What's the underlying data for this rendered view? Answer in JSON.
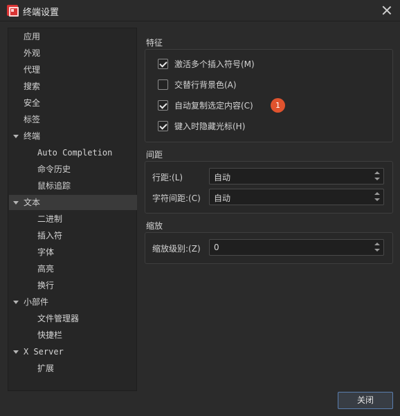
{
  "window": {
    "title": "终端设置"
  },
  "sidebar": {
    "items": [
      {
        "label": "应用",
        "level": 0,
        "expandable": false,
        "selected": false,
        "mono": false
      },
      {
        "label": "外观",
        "level": 0,
        "expandable": false,
        "selected": false,
        "mono": false
      },
      {
        "label": "代理",
        "level": 0,
        "expandable": false,
        "selected": false,
        "mono": false
      },
      {
        "label": "搜索",
        "level": 0,
        "expandable": false,
        "selected": false,
        "mono": false
      },
      {
        "label": "安全",
        "level": 0,
        "expandable": false,
        "selected": false,
        "mono": false
      },
      {
        "label": "标签",
        "level": 0,
        "expandable": false,
        "selected": false,
        "mono": false
      },
      {
        "label": "终端",
        "level": 0,
        "expandable": true,
        "selected": false,
        "mono": false
      },
      {
        "label": "Auto Completion",
        "level": 1,
        "expandable": false,
        "selected": false,
        "mono": true
      },
      {
        "label": "命令历史",
        "level": 1,
        "expandable": false,
        "selected": false,
        "mono": false
      },
      {
        "label": "鼠标追踪",
        "level": 1,
        "expandable": false,
        "selected": false,
        "mono": false
      },
      {
        "label": "文本",
        "level": 0,
        "expandable": true,
        "selected": true,
        "mono": false
      },
      {
        "label": "二进制",
        "level": 1,
        "expandable": false,
        "selected": false,
        "mono": false
      },
      {
        "label": "插入符",
        "level": 1,
        "expandable": false,
        "selected": false,
        "mono": false
      },
      {
        "label": "字体",
        "level": 1,
        "expandable": false,
        "selected": false,
        "mono": false
      },
      {
        "label": "高亮",
        "level": 1,
        "expandable": false,
        "selected": false,
        "mono": false
      },
      {
        "label": "换行",
        "level": 1,
        "expandable": false,
        "selected": false,
        "mono": false
      },
      {
        "label": "小部件",
        "level": 0,
        "expandable": true,
        "selected": false,
        "mono": false
      },
      {
        "label": "文件管理器",
        "level": 1,
        "expandable": false,
        "selected": false,
        "mono": false
      },
      {
        "label": "快捷栏",
        "level": 1,
        "expandable": false,
        "selected": false,
        "mono": false
      },
      {
        "label": "X Server",
        "level": 0,
        "expandable": true,
        "selected": false,
        "mono": true
      },
      {
        "label": "扩展",
        "level": 1,
        "expandable": false,
        "selected": false,
        "mono": false
      }
    ]
  },
  "features": {
    "title": "特征",
    "options": [
      {
        "label": "激活多个插入符号(M)",
        "checked": true
      },
      {
        "label": "交替行背景色(A)",
        "checked": false
      },
      {
        "label": "自动复制选定内容(C)",
        "checked": true
      },
      {
        "label": "键入时隐藏光标(H)",
        "checked": true
      }
    ],
    "badge": "1"
  },
  "spacing": {
    "title": "间距",
    "line_spacing_label": "行距:(L)",
    "line_spacing_value": "自动",
    "char_spacing_label": "字符间距:(C)",
    "char_spacing_value": "自动"
  },
  "zoom": {
    "title": "缩放",
    "level_label": "缩放级别:(Z)",
    "level_value": "0"
  },
  "footer": {
    "close_label": "关闭"
  },
  "colors": {
    "accent_border": "#5b7fb0",
    "badge": "#e0532e",
    "app_icon": "#d93434"
  }
}
